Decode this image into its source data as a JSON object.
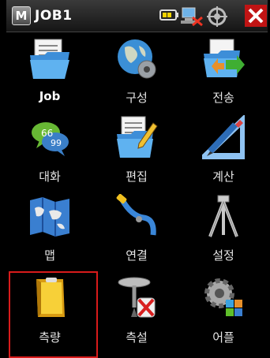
{
  "titlebar": {
    "logo": "M",
    "title": "JOB1"
  },
  "status_icons": [
    "battery-icon",
    "network-icon",
    "satellite-icon",
    "close-icon"
  ],
  "menu": [
    {
      "label": "Job",
      "icon": "folder-document-icon",
      "bold": true
    },
    {
      "label": "구성",
      "icon": "globe-gear-icon"
    },
    {
      "label": "전송",
      "icon": "folder-transfer-icon"
    },
    {
      "label": "대화",
      "icon": "chat-bubbles-icon"
    },
    {
      "label": "편집",
      "icon": "folder-edit-icon"
    },
    {
      "label": "계산",
      "icon": "ruler-pencil-icon"
    },
    {
      "label": "맵",
      "icon": "map-icon"
    },
    {
      "label": "연결",
      "icon": "cable-icon"
    },
    {
      "label": "설정",
      "icon": "tripod-icon"
    },
    {
      "label": "측량",
      "icon": "survey-book-icon",
      "selected": true
    },
    {
      "label": "측설",
      "icon": "stakeout-icon"
    },
    {
      "label": "어플",
      "icon": "apps-gear-icon"
    }
  ],
  "colors": {
    "selection": "#d81b1b",
    "background": "#000000"
  }
}
